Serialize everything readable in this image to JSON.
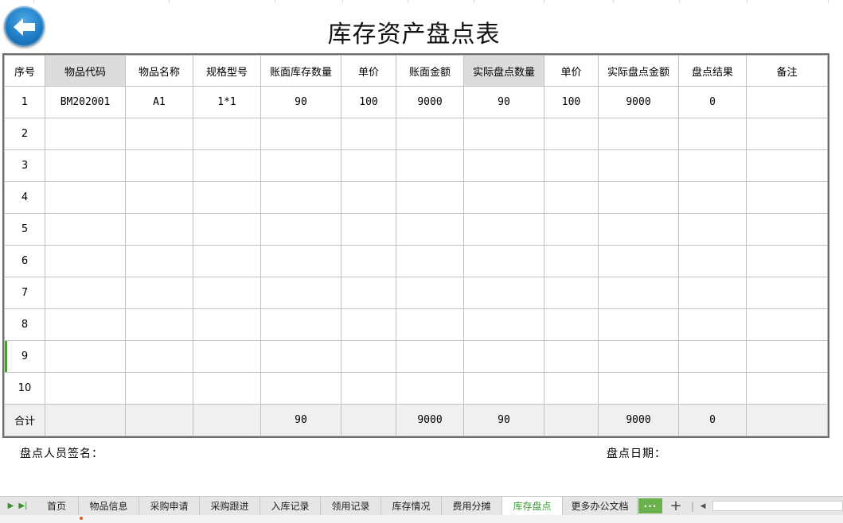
{
  "sheet": {
    "title": "库存资产盘点表",
    "headers": [
      "序号",
      "物品代码",
      "物品名称",
      "规格型号",
      "账面库存数量",
      "单价",
      "账面金额",
      "实际盘点数量",
      "单价",
      "实际盘点金额",
      "盘点结果",
      "备注"
    ],
    "rows": [
      [
        "1",
        "BM202001",
        "A1",
        "1*1",
        "90",
        "100",
        "9000",
        "90",
        "100",
        "9000",
        "0",
        ""
      ],
      [
        "2",
        "",
        "",
        "",
        "",
        "",
        "",
        "",
        "",
        "",
        "",
        ""
      ],
      [
        "3",
        "",
        "",
        "",
        "",
        "",
        "",
        "",
        "",
        "",
        "",
        ""
      ],
      [
        "4",
        "",
        "",
        "",
        "",
        "",
        "",
        "",
        "",
        "",
        "",
        ""
      ],
      [
        "5",
        "",
        "",
        "",
        "",
        "",
        "",
        "",
        "",
        "",
        "",
        ""
      ],
      [
        "6",
        "",
        "",
        "",
        "",
        "",
        "",
        "",
        "",
        "",
        "",
        ""
      ],
      [
        "7",
        "",
        "",
        "",
        "",
        "",
        "",
        "",
        "",
        "",
        "",
        ""
      ],
      [
        "8",
        "",
        "",
        "",
        "",
        "",
        "",
        "",
        "",
        "",
        "",
        ""
      ],
      [
        "9",
        "",
        "",
        "",
        "",
        "",
        "",
        "",
        "",
        "",
        "",
        ""
      ],
      [
        "10",
        "",
        "",
        "",
        "",
        "",
        "",
        "",
        "",
        "",
        "",
        ""
      ]
    ],
    "total_row": [
      "合计",
      "",
      "",
      "",
      "90",
      "",
      "9000",
      "90",
      "",
      "9000",
      "0",
      ""
    ],
    "signature_label": "盘点人员签名：",
    "date_label": "盘点日期："
  },
  "icons": {
    "back": "back-arrow-icon"
  },
  "tabs": [
    {
      "label": "首页",
      "active": false
    },
    {
      "label": "物品信息",
      "active": false
    },
    {
      "label": "采购申请",
      "active": false
    },
    {
      "label": "采购跟进",
      "active": false
    },
    {
      "label": "入库记录",
      "active": false
    },
    {
      "label": "领用记录",
      "active": false
    },
    {
      "label": "库存情况",
      "active": false
    },
    {
      "label": "费用分摊",
      "active": false
    },
    {
      "label": "库存盘点",
      "active": true
    },
    {
      "label": "更多办公文档",
      "active": false
    }
  ],
  "tab_controls": {
    "more_label": "···",
    "add_label": "+"
  },
  "colors": {
    "accent_green": "#3d9b35",
    "header_highlight": "#dcdcdc",
    "back_button_blue": "#1e7cc4"
  }
}
